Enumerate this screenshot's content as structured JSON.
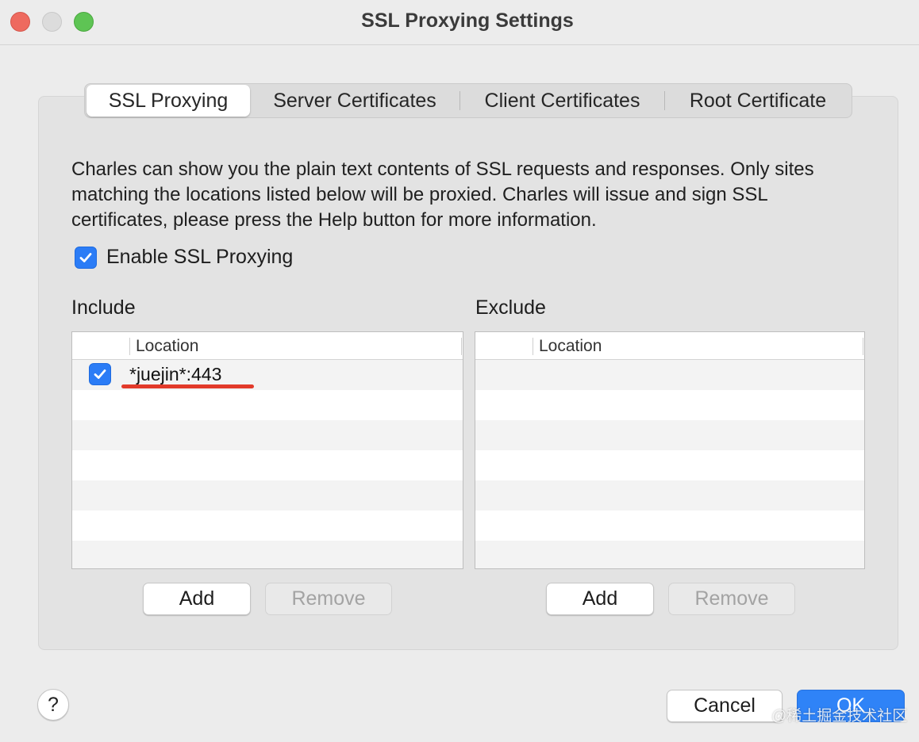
{
  "window": {
    "title": "SSL Proxying Settings"
  },
  "tabs": [
    {
      "label": "SSL Proxying",
      "active": true
    },
    {
      "label": "Server Certificates",
      "active": false
    },
    {
      "label": "Client Certificates",
      "active": false
    },
    {
      "label": "Root Certificate",
      "active": false
    }
  ],
  "description": "Charles can show you the plain text contents of SSL requests and responses. Only sites matching the locations listed below will be proxied. Charles will issue and sign SSL certificates, please press the Help button for more information.",
  "enable_ssl": {
    "label": "Enable SSL Proxying",
    "checked": true
  },
  "include": {
    "title": "Include",
    "column_header": "Location",
    "rows": [
      {
        "location": "*juejin*:443",
        "enabled": true
      }
    ],
    "add_label": "Add",
    "remove_label": "Remove"
  },
  "exclude": {
    "title": "Exclude",
    "column_header": "Location",
    "rows": [],
    "add_label": "Add",
    "remove_label": "Remove"
  },
  "footer": {
    "help_label": "?",
    "cancel_label": "Cancel",
    "ok_label": "OK",
    "watermark": "@稀土掘金技术社区"
  },
  "colors": {
    "accent": "#2b7cf6",
    "annotation_underline": "#e23a2a"
  }
}
